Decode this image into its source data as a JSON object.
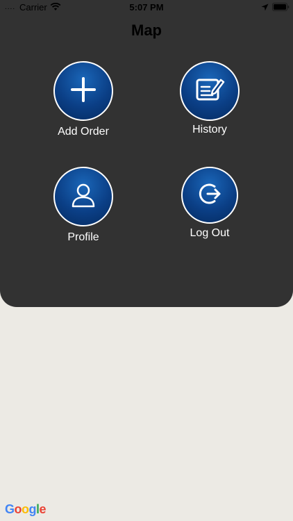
{
  "status_bar": {
    "signal": "....",
    "carrier": "Carrier",
    "time": "5:07 PM"
  },
  "header": {
    "title": "Map"
  },
  "menu": {
    "add_order": "Add Order",
    "history": "History",
    "profile": "Profile",
    "log_out": "Log Out"
  },
  "icons": {
    "add_order": "plus-icon",
    "history": "edit-document-icon",
    "profile": "user-icon",
    "log_out": "logout-icon"
  },
  "colors": {
    "panel": "#323232",
    "map_background": "#eceae4",
    "button_blue": "#0b3f86"
  },
  "map": {
    "attribution": [
      "G",
      "o",
      "o",
      "g",
      "l",
      "e"
    ]
  }
}
